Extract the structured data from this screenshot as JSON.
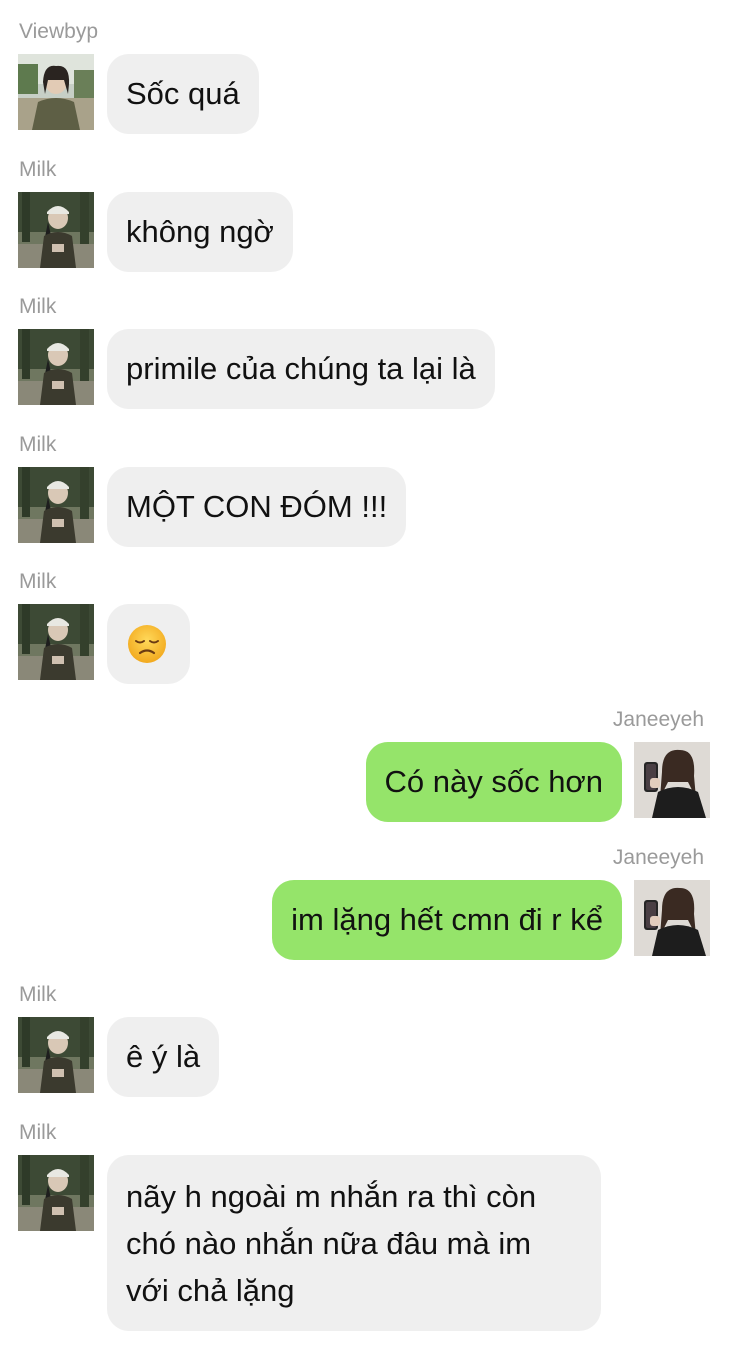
{
  "messages": [
    {
      "sender": "Viewbyp",
      "text": "Sốc quá"
    },
    {
      "sender": "Milk",
      "text": "không ngờ"
    },
    {
      "sender": "Milk",
      "text": "primile của chúng ta lại là"
    },
    {
      "sender": "Milk",
      "text": "MỘT CON ĐÓM !!!"
    },
    {
      "sender": "Milk",
      "text": "",
      "emoji": "disappointed-face"
    },
    {
      "sender": "Janeeyeh",
      "text": "Có này sốc hơn"
    },
    {
      "sender": "Janeeyeh",
      "text": "im lặng hết cmn đi r kể"
    },
    {
      "sender": "Milk",
      "text": "ê ý là"
    },
    {
      "sender": "Milk",
      "lines": [
        "nãy h ngoài m nhắn ra thì còn",
        "chó nào nhắn nữa đâu mà im",
        "với chả lặng"
      ]
    }
  ],
  "colors": {
    "incoming_bubble": "#efefef",
    "outgoing_bubble": "#95e46a",
    "sender_name": "#9a9a9a"
  }
}
